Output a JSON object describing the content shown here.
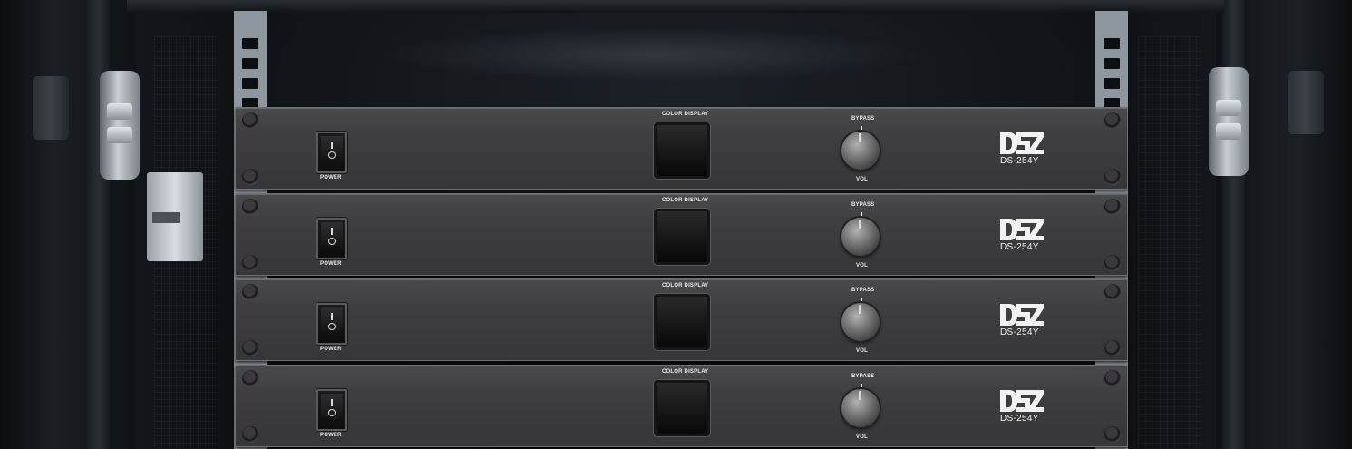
{
  "scene": {
    "description_colors": {
      "panel": "#3e3e40",
      "rail": "#8e979f",
      "background": "#0b0d10"
    }
  },
  "units": [
    {
      "power_label": "POWER",
      "display_label": "COLOR DISPLAY",
      "bypass_label": "BYPASS",
      "vol_label": "VOL",
      "brand": "DSZ",
      "model": "DS-254Y"
    },
    {
      "power_label": "POWER",
      "display_label": "COLOR DISPLAY",
      "bypass_label": "BYPASS",
      "vol_label": "VOL",
      "brand": "DSZ",
      "model": "DS-254Y"
    },
    {
      "power_label": "POWER",
      "display_label": "COLOR DISPLAY",
      "bypass_label": "BYPASS",
      "vol_label": "VOL",
      "brand": "DSZ",
      "model": "DS-254Y"
    },
    {
      "power_label": "POWER",
      "display_label": "COLOR DISPLAY",
      "bypass_label": "BYPASS",
      "vol_label": "VOL",
      "brand": "DSZ",
      "model": "DS-254Y"
    }
  ]
}
